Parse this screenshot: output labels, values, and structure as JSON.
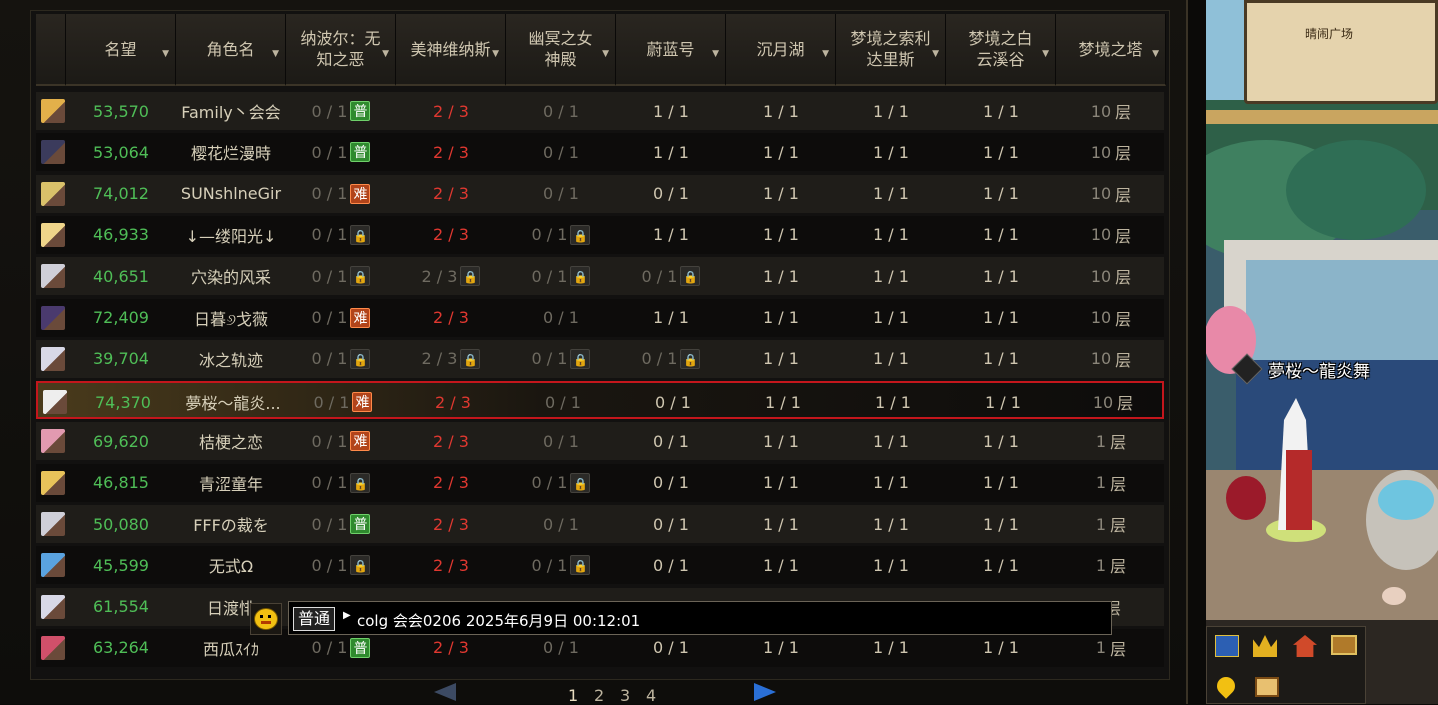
{
  "headers": [
    {
      "label": "名望"
    },
    {
      "label": "角色名"
    },
    {
      "label": "纳波尔：无知之恶"
    },
    {
      "label": "美神维纳斯"
    },
    {
      "label": "幽冥之女神殿"
    },
    {
      "label": "蔚蓝号"
    },
    {
      "label": "沉月湖"
    },
    {
      "label": "梦境之索利达里斯"
    },
    {
      "label": "梦境之白云溪谷"
    },
    {
      "label": "梦境之塔"
    }
  ],
  "rows": [
    {
      "fame": "53,570",
      "name": "Family丶会会",
      "c3": "0 / 1",
      "b3": "普",
      "c4": "2 / 3",
      "c5": "0 / 1",
      "c6": "1 / 1",
      "c7": "1 / 1",
      "c8": "1 / 1",
      "c9": "1 / 1",
      "floor_num": "10",
      "floor": "层",
      "avatar_color": "#e3b04a"
    },
    {
      "fame": "53,064",
      "name": "樱花烂漫時",
      "c3": "0 / 1",
      "b3": "普",
      "c4": "2 / 3",
      "c5": "0 / 1",
      "c6": "1 / 1",
      "c7": "1 / 1",
      "c8": "1 / 1",
      "c9": "1 / 1",
      "floor_num": "10",
      "floor": "层",
      "avatar_color": "#3b3b5c"
    },
    {
      "fame": "74,012",
      "name": "SUNshlneGir",
      "c3": "0 / 1",
      "b3": "难",
      "c4": "2 / 3",
      "c5": "0 / 1",
      "c6": "0 / 1",
      "c7": "1 / 1",
      "c8": "1 / 1",
      "c9": "1 / 1",
      "floor_num": "10",
      "floor": "层",
      "avatar_color": "#d9c16a"
    },
    {
      "fame": "46,933",
      "name": "↓—缕阳光↓",
      "c3": "0 / 1",
      "b3": "锁",
      "c4": "2 / 3",
      "c5": "0 / 1",
      "b5": "锁",
      "c6": "1 / 1",
      "c7": "1 / 1",
      "c8": "1 / 1",
      "c9": "1 / 1",
      "floor_num": "10",
      "floor": "层",
      "avatar_color": "#efd58a"
    },
    {
      "fame": "40,651",
      "name": "穴染的风采",
      "c3": "0 / 1",
      "b3": "锁",
      "c4": "2 / 3",
      "b4": "锁",
      "c5": "0 / 1",
      "b5": "锁",
      "c6": "0 / 1",
      "b6": "锁",
      "c7": "1 / 1",
      "c8": "1 / 1",
      "c9": "1 / 1",
      "floor_num": "10",
      "floor": "层",
      "avatar_color": "#cfcfd8"
    },
    {
      "fame": "72,409",
      "name": "日暮୬戈薇",
      "c3": "0 / 1",
      "b3": "难",
      "c4": "2 / 3",
      "c5": "0 / 1",
      "c6": "1 / 1",
      "c7": "1 / 1",
      "c8": "1 / 1",
      "c9": "1 / 1",
      "floor_num": "10",
      "floor": "层",
      "avatar_color": "#4a3a6e"
    },
    {
      "fame": "39,704",
      "name": "冰之轨迹",
      "c3": "0 / 1",
      "b3": "锁",
      "c4": "2 / 3",
      "b4": "锁",
      "c5": "0 / 1",
      "b5": "锁",
      "c6": "0 / 1",
      "b6": "锁",
      "c7": "1 / 1",
      "c8": "1 / 1",
      "c9": "1 / 1",
      "floor_num": "10",
      "floor": "层",
      "avatar_color": "#d8d8e6"
    },
    {
      "fame": "74,370",
      "name": "夢桜～龍炎...",
      "c3": "0 / 1",
      "b3": "难",
      "c4": "2 / 3",
      "c5": "0 / 1",
      "c6": "0 / 1",
      "c7": "1 / 1",
      "c8": "1 / 1",
      "c9": "1 / 1",
      "floor_num": "10",
      "floor": "层",
      "avatar_color": "#eeeeee",
      "selected": true
    },
    {
      "fame": "69,620",
      "name": "桔梗之恋",
      "c3": "0 / 1",
      "b3": "难",
      "c4": "2 / 3",
      "c5": "0 / 1",
      "c6": "0 / 1",
      "c7": "1 / 1",
      "c8": "1 / 1",
      "c9": "1 / 1",
      "floor_num": "1",
      "floor": "层",
      "avatar_color": "#e29ab0"
    },
    {
      "fame": "46,815",
      "name": "青涩童年",
      "c3": "0 / 1",
      "b3": "锁",
      "c4": "2 / 3",
      "c5": "0 / 1",
      "b5": "锁",
      "c6": "0 / 1",
      "c7": "1 / 1",
      "c8": "1 / 1",
      "c9": "1 / 1",
      "floor_num": "1",
      "floor": "层",
      "avatar_color": "#e8c35a"
    },
    {
      "fame": "50,080",
      "name": "FFFの裁を",
      "c3": "0 / 1",
      "b3": "普",
      "c4": "2 / 3",
      "c5": "0 / 1",
      "c6": "0 / 1",
      "c7": "1 / 1",
      "c8": "1 / 1",
      "c9": "1 / 1",
      "floor_num": "1",
      "floor": "层",
      "avatar_color": "#cfcfd8"
    },
    {
      "fame": "45,599",
      "name": "无式Ω",
      "c3": "0 / 1",
      "b3": "锁",
      "c4": "2 / 3",
      "c5": "0 / 1",
      "b5": "锁",
      "c6": "0 / 1",
      "c7": "1 / 1",
      "c8": "1 / 1",
      "c9": "1 / 1",
      "floor_num": "1",
      "floor": "层",
      "avatar_color": "#5aa3e0"
    },
    {
      "fame": "61,554",
      "name": "日渡悱",
      "c3": "",
      "c4": "",
      "c5": "",
      "c6": "",
      "c7": "",
      "c8": "",
      "c9": "",
      "floor_num": "",
      "floor": "层",
      "avatar_color": "#d8d8e6"
    },
    {
      "fame": "63,264",
      "name": "西瓜ｽｲｶ",
      "c3": "0 / 1",
      "b3": "普",
      "c4": "2 / 3",
      "c5": "0 / 1",
      "c6": "0 / 1",
      "c7": "1 / 1",
      "c8": "1 / 1",
      "c9": "1 / 1",
      "floor_num": "1",
      "floor": "层",
      "avatar_color": "#d0506a"
    }
  ],
  "chat": {
    "channel": "普通",
    "text": "colg 会会0206  2025年6月9日  00:12:01"
  },
  "pager": {
    "pages": [
      "1",
      "2",
      "3",
      "4"
    ],
    "current": "1"
  },
  "map": {
    "place": "晴闹广场"
  },
  "character_nameplate": "夢桜～龍炎舞"
}
